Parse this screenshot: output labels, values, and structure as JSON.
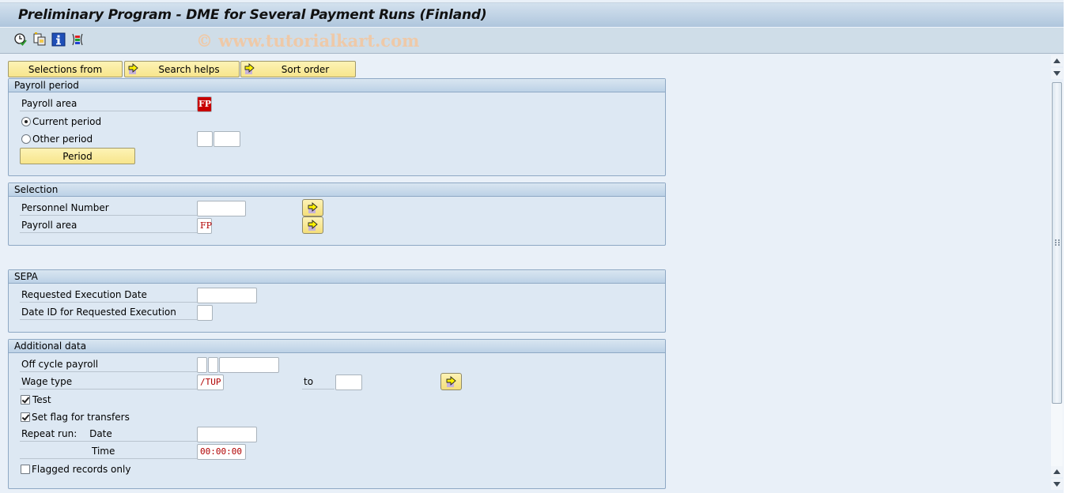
{
  "window": {
    "title": "Preliminary Program - DME for Several Payment Runs (Finland)"
  },
  "toolbar": {
    "icons": [
      "execute-in-background-icon",
      "copy-variant-icon",
      "program-documentation-icon",
      "selection-options-icon"
    ],
    "watermark": "© www.tutorialkart.com"
  },
  "top_buttons": {
    "selections_from": "Selections from",
    "search_helps": "Search helps",
    "sort_order": "Sort order"
  },
  "payroll_period": {
    "header": "Payroll period",
    "payroll_area_label": "Payroll area",
    "payroll_area_value": "FP",
    "current_period_label": "Current period",
    "current_period_selected": true,
    "other_period_label": "Other period",
    "other_period_selected": false,
    "other_period_num": "",
    "other_period_year": "",
    "period_button": "Period"
  },
  "selection": {
    "header": "Selection",
    "personnel_number_label": "Personnel Number",
    "personnel_number_value": "",
    "payroll_area_label": "Payroll area",
    "payroll_area_value": "FP"
  },
  "sepa": {
    "header": "SEPA",
    "req_exec_date_label": "Requested Execution Date",
    "req_exec_date_value": "",
    "date_id_label": "Date ID for Requested Execution",
    "date_id_value": ""
  },
  "additional_data": {
    "header": "Additional data",
    "off_cycle_label": "Off cycle payroll",
    "off_cycle_values": [
      "",
      "",
      ""
    ],
    "wage_type_label": "Wage type",
    "wage_type_from": "/TUP",
    "to_label": "to",
    "wage_type_to": "",
    "test_label": "Test",
    "test_checked": true,
    "set_flag_label": "Set flag for transfers",
    "set_flag_checked": true,
    "repeat_run_label": "Repeat run:",
    "date_label": "Date",
    "repeat_date_value": "",
    "time_label": "Time",
    "repeat_time_value": "00:00:00",
    "flagged_only_label": "Flagged records only",
    "flagged_only_checked": false
  },
  "colors": {
    "button_yellow": "#f7e58c",
    "group_bg": "#dde8f3",
    "required_red": "#c80000"
  }
}
